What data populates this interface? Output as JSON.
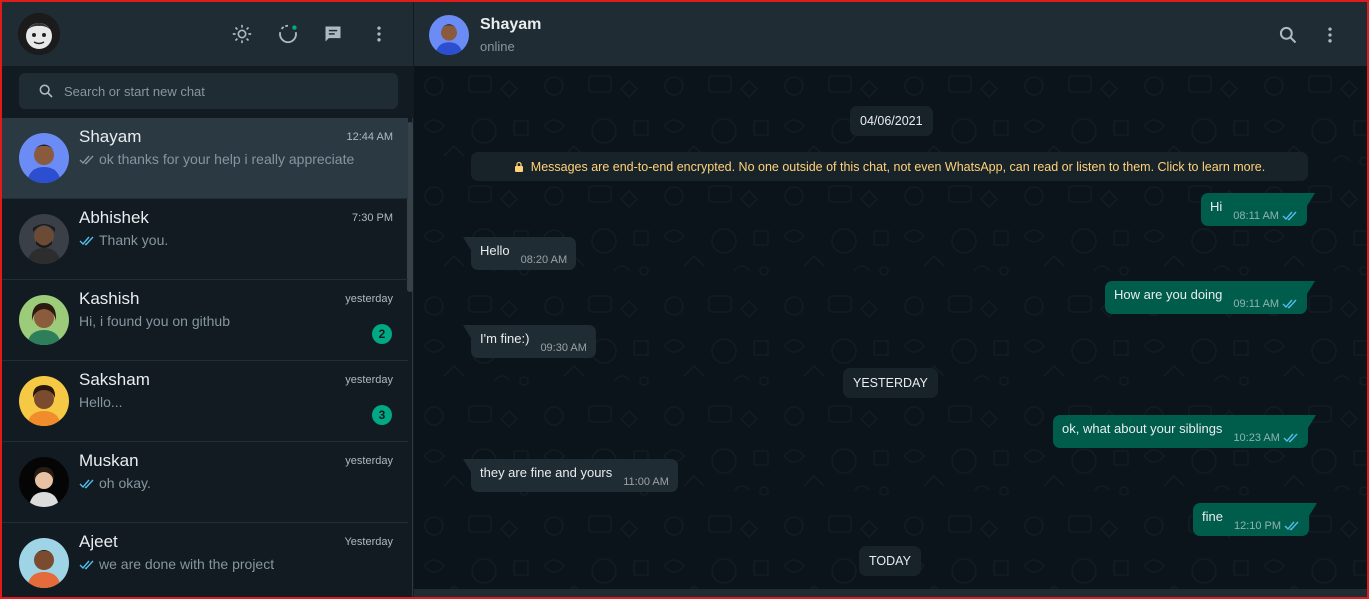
{
  "theme": {
    "accent": "#00a884",
    "outgoing_bubble": "#005c4b",
    "incoming_bubble": "#202c33",
    "encryption_text": "#ffd279",
    "tick_read": "#53bdeb"
  },
  "sidebar": {
    "header_icons": [
      "theme-toggle-icon",
      "status-icon",
      "new-chat-icon",
      "menu-icon"
    ],
    "search": {
      "placeholder": "Search or start new chat"
    },
    "chats": [
      {
        "name": "Shayam",
        "time": "12:44 AM",
        "preview": "ok thanks for your help i really appreciate",
        "tick": true,
        "unread": null,
        "active": true
      },
      {
        "name": "Abhishek",
        "time": "7:30 PM",
        "preview": "Thank you.",
        "tick": true,
        "unread": null
      },
      {
        "name": "Kashish",
        "time": "yesterday",
        "preview": "Hi, i found you on github",
        "tick": false,
        "unread": "2"
      },
      {
        "name": "Saksham",
        "time": "yesterday",
        "preview": "Hello...",
        "tick": false,
        "unread": "3"
      },
      {
        "name": "Muskan",
        "time": "yesterday",
        "preview": "oh okay.",
        "tick": true,
        "unread": null
      },
      {
        "name": "Ajeet",
        "time": "Yesterday",
        "preview": "we are done with the project",
        "tick": true,
        "unread": null
      }
    ]
  },
  "conversation": {
    "contact_name": "Shayam",
    "contact_status": "online",
    "header_icons": [
      "search-icon",
      "menu-icon"
    ],
    "encryption_notice": "Messages are end-to-end encrypted. No one outside of this chat, not even WhatsApp, can read or listen to them. Click to learn more.",
    "date_dividers": [
      "04/06/2021",
      "YESTERDAY",
      "TODAY"
    ],
    "messages": [
      {
        "direction": "out",
        "text": "Hi",
        "time": "08:11 AM"
      },
      {
        "direction": "in",
        "text": "Hello",
        "time": "08:20 AM"
      },
      {
        "direction": "out",
        "text": "How are you doing",
        "time": "09:11 AM"
      },
      {
        "direction": "in",
        "text": "I'm fine:)",
        "time": "09:30 AM"
      },
      {
        "direction": "out",
        "text": "ok, what about your siblings",
        "time": "10:23 AM"
      },
      {
        "direction": "in",
        "text": "they are fine and yours",
        "time": "11:00 AM"
      },
      {
        "direction": "out",
        "text": "fine",
        "time": "12:10 PM"
      }
    ]
  }
}
